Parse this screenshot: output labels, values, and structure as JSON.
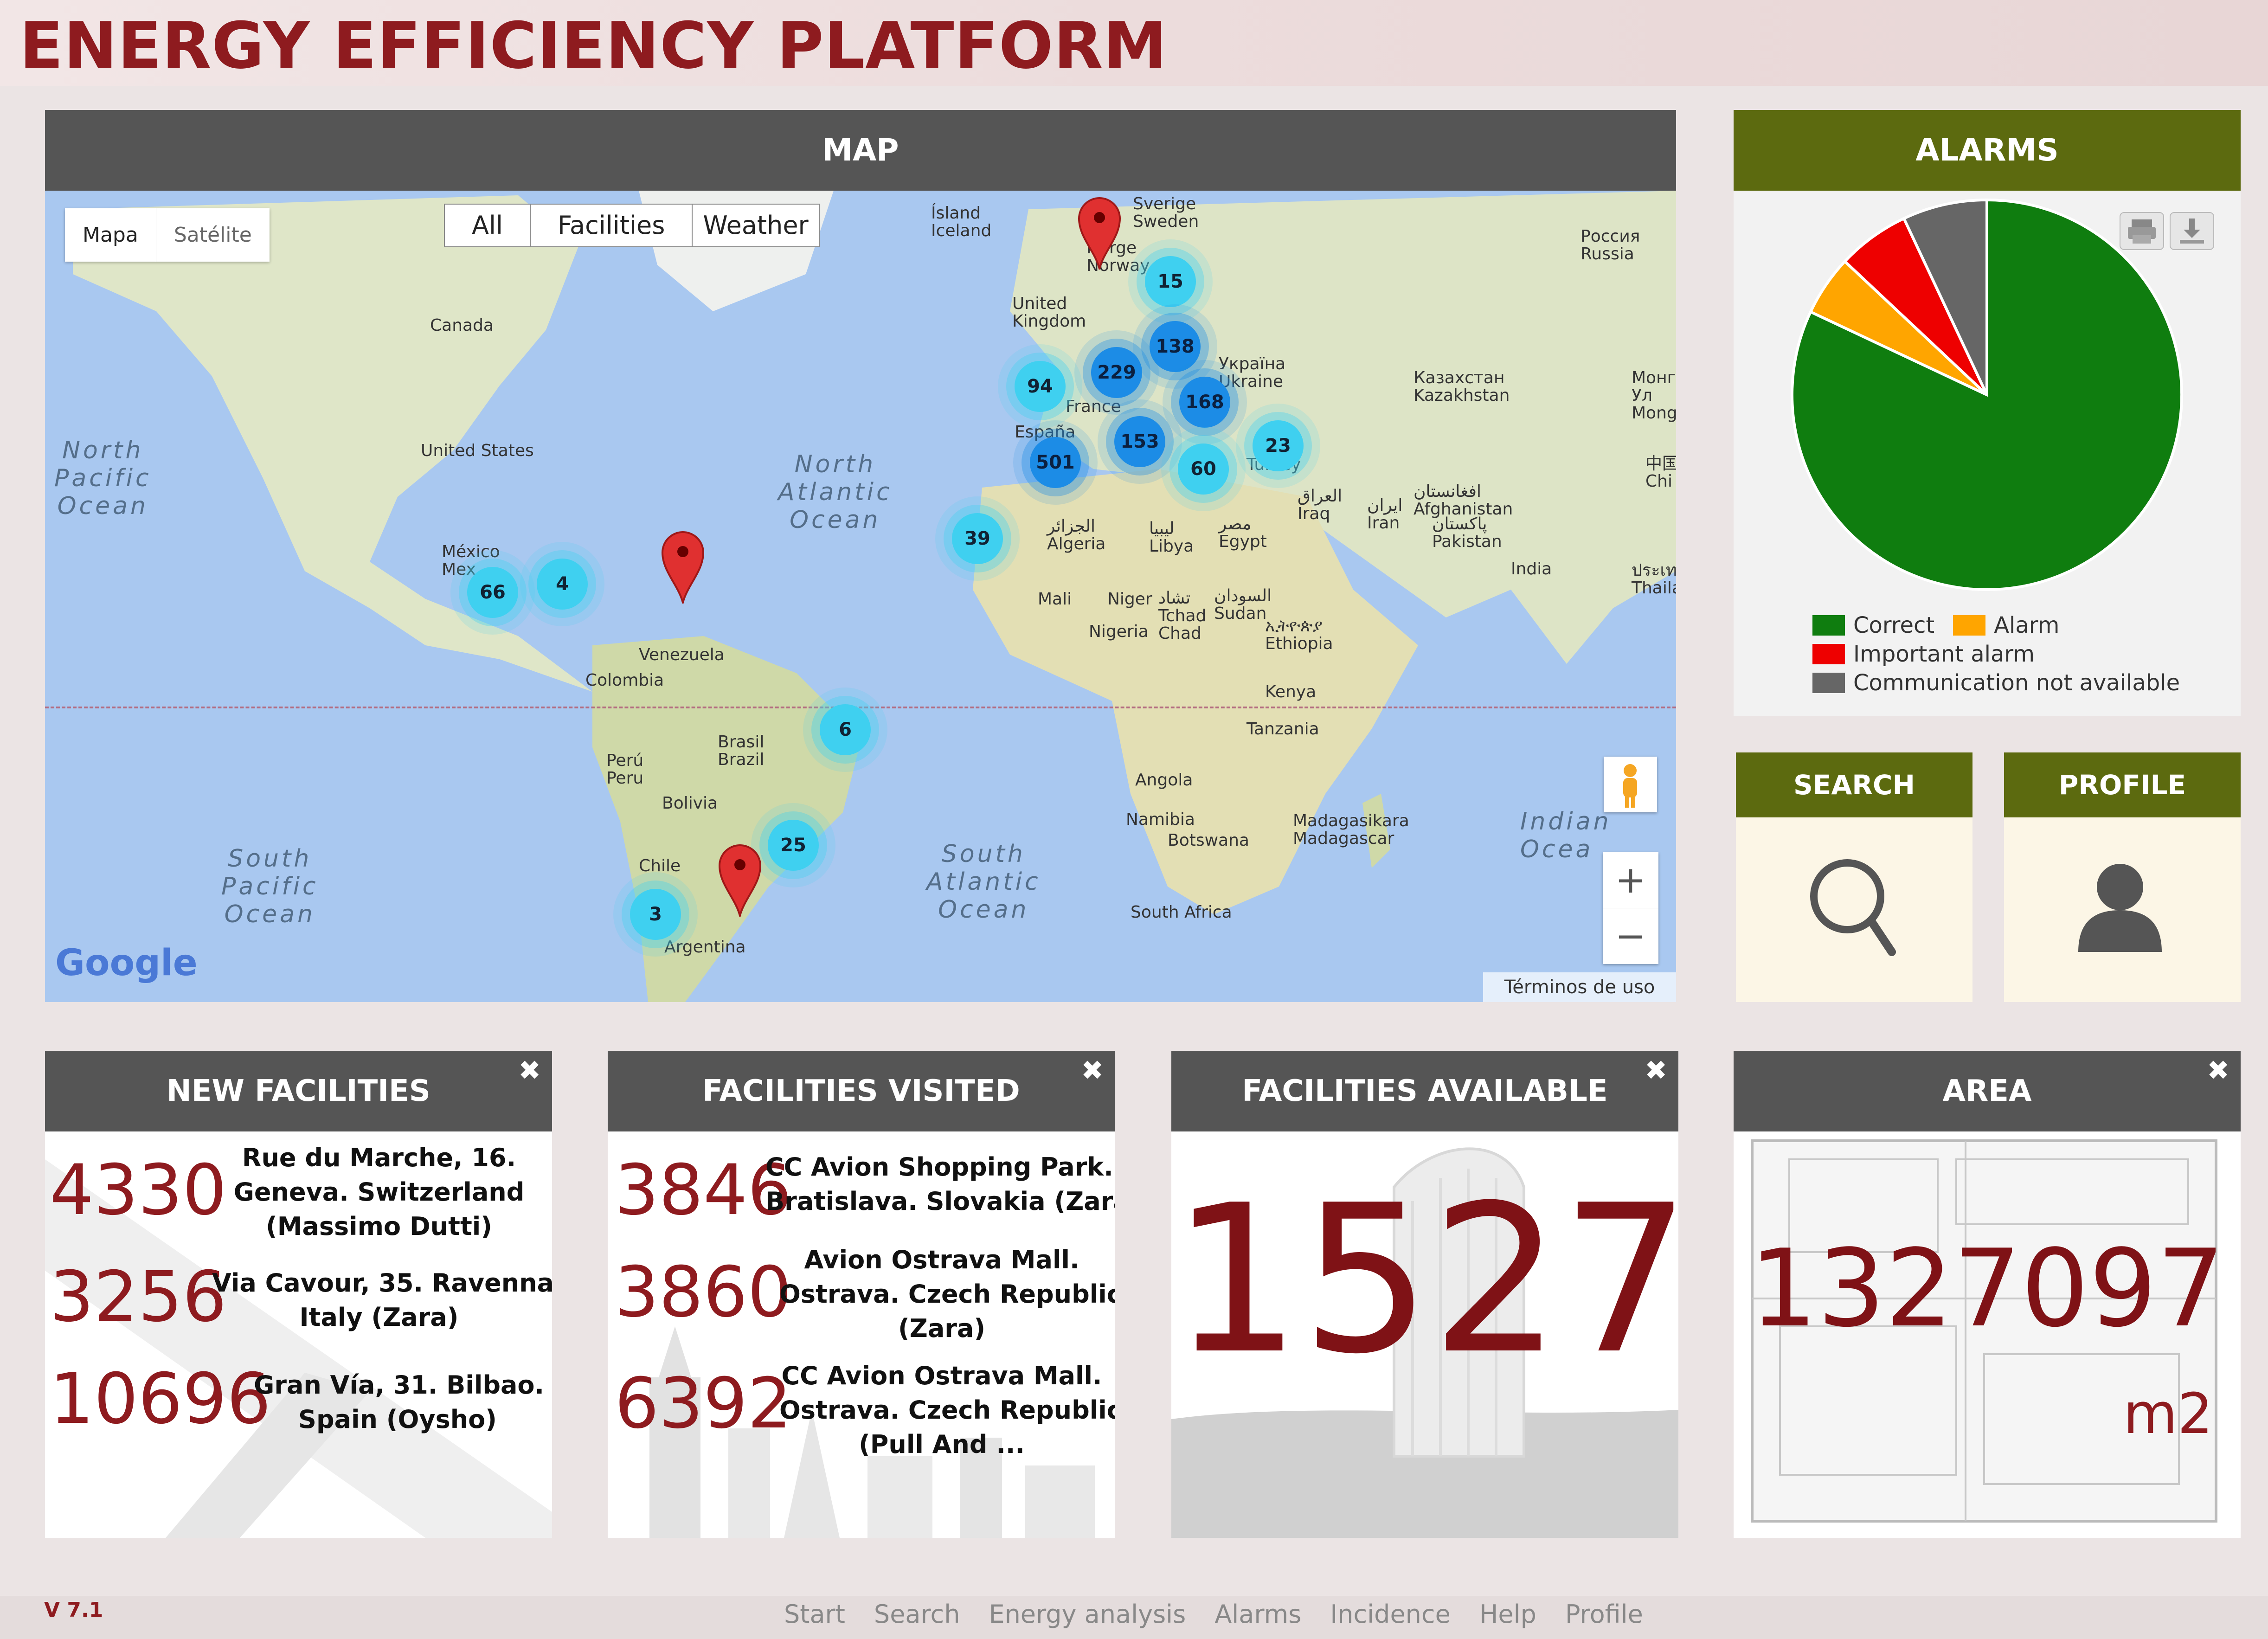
{
  "app": {
    "title": "ENERGY EFFICIENCY PLATFORM",
    "version": "V 7.1"
  },
  "map": {
    "header": "MAP",
    "map_type": {
      "map": "Mapa",
      "satellite": "Satélite"
    },
    "filters": [
      "All",
      "Facilities",
      "Weather"
    ],
    "zoom_in": "+",
    "zoom_out": "−",
    "logo": "Google",
    "terms": "Términos de uso",
    "labels": {
      "canada": "Canada",
      "united_states": "United States",
      "mexico": "México\nMex",
      "venezuela": "Venezuela",
      "colombia": "Colombia",
      "peru": "Perú\nPeru",
      "brasil": "Brasil\nBrazil",
      "bolivia": "Bolivia",
      "chile": "Chile",
      "argentina": "Argentina",
      "island": "Ísland\nIceland",
      "sverige": "Sverige\nSweden",
      "norge": "Norge\nNorway",
      "uk": "United\nKingdom",
      "russia": "Россия\nRussia",
      "ukraine": "Україна\nUkraine",
      "kazakhstan": "Казахстан\nKazakhstan",
      "mongolia": "Монг\nУл\nMong",
      "china": "中国\nChi",
      "espana": "España",
      "france": "France",
      "turkey": "Turkey",
      "iraq": "العراق\nIraq",
      "iran": "ایران\nIran",
      "afghanistan": "افغانستان\nAfghanistan",
      "pakistan": "پاکستان\nPakistan",
      "india": "India",
      "thailand": "ประเทศไ\nThailan",
      "algeria": "الجزائر\nAlgeria",
      "libya": "ليبيا\nLibya",
      "egypt": "مصر\nEgypt",
      "mali": "Mali",
      "niger": "Niger",
      "chad": "تشاد\nTchad\nChad",
      "sudan": "السودان\nSudan",
      "nigeria": "Nigeria",
      "ethiopia": "ኢትዮጵያ\nEthiopia",
      "kenya": "Kenya",
      "tanzania": "Tanzania",
      "angola": "Angola",
      "namibia": "Namibia",
      "botswana": "Botswana",
      "madagascar": "Madagasikara\nMadagascar",
      "south_africa": "South Africa"
    },
    "oceans": {
      "north_pacific": "North\nPacific\nOcean",
      "north_atlantic": "North\nAtlantic\nOcean",
      "south_pacific": "South\nPacific\nOcean",
      "south_atlantic": "South\nAtlantic\nOcean",
      "indian": "Indian\nOcea"
    },
    "clusters": [
      {
        "label": "15",
        "tone": "light"
      },
      {
        "label": "138",
        "tone": "dark"
      },
      {
        "label": "229",
        "tone": "dark"
      },
      {
        "label": "94",
        "tone": "light"
      },
      {
        "label": "168",
        "tone": "dark"
      },
      {
        "label": "153",
        "tone": "dark"
      },
      {
        "label": "501",
        "tone": "dark"
      },
      {
        "label": "60",
        "tone": "light"
      },
      {
        "label": "23",
        "tone": "light"
      },
      {
        "label": "39",
        "tone": "light"
      },
      {
        "label": "66",
        "tone": "light"
      },
      {
        "label": "4",
        "tone": "light"
      },
      {
        "label": "6",
        "tone": "light"
      },
      {
        "label": "25",
        "tone": "light"
      },
      {
        "label": "3",
        "tone": "light"
      }
    ]
  },
  "alarms": {
    "header": "ALARMS",
    "chart_data": {
      "type": "pie",
      "slices": [
        {
          "name": "Correct",
          "value": 82,
          "color": "#0f7d0f"
        },
        {
          "name": "Alarm",
          "value": 5,
          "color": "#ffa500"
        },
        {
          "name": "Important alarm",
          "value": 6,
          "color": "#ee0000"
        },
        {
          "name": "Communication not available",
          "value": 7,
          "color": "#666666"
        }
      ],
      "legend_position": "bottom",
      "legend": [
        "Correct",
        "Alarm",
        "Important alarm",
        "Communication not available"
      ]
    }
  },
  "search": {
    "header": "SEARCH"
  },
  "profile": {
    "header": "PROFILE"
  },
  "new_facilities": {
    "header": "NEW FACILITIES",
    "items": [
      {
        "number": "4330",
        "text": "Rue du Marche, 16.\nGeneva. Switzerland\n(Massimo Dutti)"
      },
      {
        "number": "3256",
        "text": "Via Cavour, 35. Ravenna.\nItaly (Zara)"
      },
      {
        "number": "10696",
        "text": "Gran Vía, 31. Bilbao.\nSpain (Oysho)"
      }
    ]
  },
  "facilities_visited": {
    "header": "FACILITIES VISITED",
    "items": [
      {
        "number": "3846",
        "text": "CC Avion Shopping Park.\nBratislava. Slovakia (Zara)"
      },
      {
        "number": "3860",
        "text": "Avion Ostrava Mall.\nOstrava. Czech Republic\n(Zara)"
      },
      {
        "number": "6392",
        "text": "CC Avion Ostrava Mall.\nOstrava. Czech Republic\n(Pull And ..."
      }
    ]
  },
  "facilities_available": {
    "header": "FACILITIES AVAILABLE",
    "value": "1527"
  },
  "area": {
    "header": "AREA",
    "value": "1327097",
    "unit": "m2"
  },
  "footer": {
    "nav": [
      "Start",
      "Search",
      "Energy analysis",
      "Alarms",
      "Incidence",
      "Help",
      "Profile"
    ]
  },
  "colors": {
    "brand": "#8e1b1f",
    "header_dark": "#555555",
    "header_olive": "#5c6a0f"
  }
}
